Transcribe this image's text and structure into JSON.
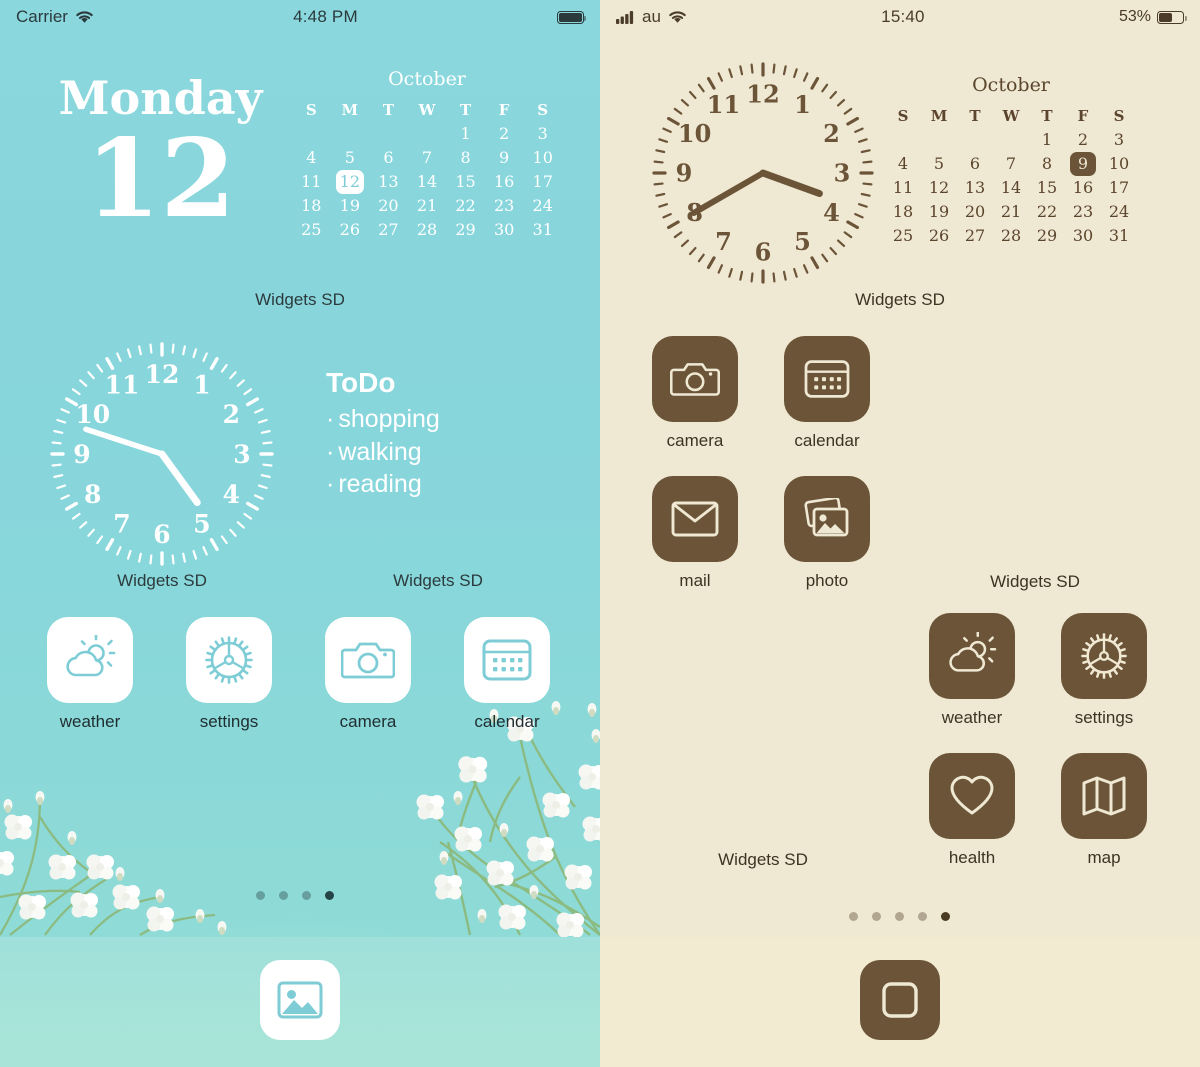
{
  "left_screen": {
    "status_bar": {
      "carrier": "Carrier",
      "wifi_icon": "wifi-icon",
      "time": "4:48 PM",
      "battery_icon": "battery-full-icon"
    },
    "date_widget": {
      "day_name": "Monday",
      "day_number": "12",
      "widget_source": "Widgets SD"
    },
    "calendar_widget": {
      "month": "October",
      "weekday_headers": [
        "S",
        "M",
        "T",
        "W",
        "T",
        "F",
        "S"
      ],
      "weeks": [
        [
          "",
          "",
          "",
          "",
          "1",
          "2",
          "3"
        ],
        [
          "4",
          "5",
          "6",
          "7",
          "8",
          "9",
          "10"
        ],
        [
          "11",
          "12",
          "13",
          "14",
          "15",
          "16",
          "17"
        ],
        [
          "18",
          "19",
          "20",
          "21",
          "22",
          "23",
          "24"
        ],
        [
          "25",
          "26",
          "27",
          "28",
          "29",
          "30",
          "31"
        ]
      ],
      "highlighted_day": "12"
    },
    "clock_widget": {
      "numerals": [
        "12",
        "1",
        "2",
        "3",
        "4",
        "5",
        "6",
        "7",
        "8",
        "9",
        "10",
        "11"
      ],
      "hour_hand_deg": 144,
      "minute_hand_deg": 288,
      "display_time": "4:48",
      "widget_source": "Widgets SD"
    },
    "todo_widget": {
      "title": "ToDo",
      "items": [
        "shopping",
        "walking",
        "reading"
      ],
      "bullet": "·",
      "widget_source": "Widgets SD"
    },
    "apps": [
      {
        "label": "weather",
        "icon": "weather-partly-cloudy-icon"
      },
      {
        "label": "settings",
        "icon": "gear-icon"
      },
      {
        "label": "camera",
        "icon": "camera-icon"
      },
      {
        "label": "calendar",
        "icon": "calendar-icon"
      }
    ],
    "dock": [
      {
        "label": "",
        "icon": "photos-icon"
      }
    ],
    "page_dots": {
      "count": 4,
      "active_index": 3
    }
  },
  "right_screen": {
    "status_bar": {
      "signal_icon": "cellular-bars-icon",
      "carrier": "au",
      "wifi_icon": "wifi-icon",
      "time": "15:40",
      "battery_percent": "53%",
      "battery_icon": "battery-half-icon"
    },
    "clock_widget": {
      "numerals": [
        "12",
        "1",
        "2",
        "3",
        "4",
        "5",
        "6",
        "7",
        "8",
        "9",
        "10",
        "11"
      ],
      "hour_hand_deg": 110,
      "minute_hand_deg": 240,
      "display_time": "15:40",
      "widget_source": "Widgets SD"
    },
    "calendar_widget": {
      "month": "October",
      "weekday_headers": [
        "S",
        "M",
        "T",
        "W",
        "T",
        "F",
        "S"
      ],
      "weeks": [
        [
          "",
          "",
          "",
          "",
          "1",
          "2",
          "3"
        ],
        [
          "4",
          "5",
          "6",
          "7",
          "8",
          "9",
          "10"
        ],
        [
          "11",
          "12",
          "13",
          "14",
          "15",
          "16",
          "17"
        ],
        [
          "18",
          "19",
          "20",
          "21",
          "22",
          "23",
          "24"
        ],
        [
          "25",
          "26",
          "27",
          "28",
          "29",
          "30",
          "31"
        ]
      ],
      "highlighted_day": "9"
    },
    "apps_top": [
      {
        "label": "camera",
        "icon": "camera-icon"
      },
      {
        "label": "calendar",
        "icon": "calendar-icon"
      },
      {
        "label": "mail",
        "icon": "mail-envelope-icon"
      },
      {
        "label": "photo",
        "icon": "photos-icon"
      }
    ],
    "apps_bottom": [
      {
        "label": "weather",
        "icon": "weather-partly-cloudy-icon"
      },
      {
        "label": "settings",
        "icon": "gear-icon"
      },
      {
        "label": "health",
        "icon": "heart-icon"
      },
      {
        "label": "map",
        "icon": "map-icon"
      }
    ],
    "widget_source_mid": "Widgets SD",
    "widget_source_right": "Widgets SD",
    "widget_source_left": "Widgets SD",
    "dock": [
      {
        "label": "",
        "icon": "rounded-square-icon"
      }
    ],
    "page_dots": {
      "count": 5,
      "active_index": 4
    }
  },
  "colors": {
    "teal_bg": "#8ad7dd",
    "teal_accent": "#7ecdd6",
    "cream_bg": "#efe8d3",
    "brown": "#6b5438",
    "brown_text": "#3e3323",
    "white": "#ffffff"
  }
}
